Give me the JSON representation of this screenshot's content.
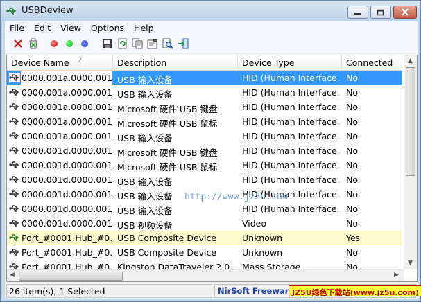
{
  "window": {
    "title": "USBDeview"
  },
  "menu": [
    "File",
    "Edit",
    "View",
    "Options",
    "Help"
  ],
  "toolbar": {
    "buttons": [
      "disconnect-icon",
      "uninstall-icon",
      "red-dot-icon",
      "green-dot-icon",
      "blue-dot-icon",
      "save-icon",
      "refresh-icon",
      "copy-icon",
      "properties-icon",
      "find-icon",
      "exit-icon"
    ],
    "colors": {
      "red": "#e00000",
      "green": "#10c010",
      "blue": "#1030e0"
    }
  },
  "columns": [
    "Device Name",
    "Description",
    "Device Type",
    "Connected"
  ],
  "rows": [
    {
      "name": "0000.001a.0000.001...",
      "description": "USB 输入设备",
      "type": "HID (Human Interface...",
      "connected": "No",
      "selected": true
    },
    {
      "name": "0000.001a.0000.001...",
      "description": "USB 输入设备",
      "type": "HID (Human Interface...",
      "connected": "No"
    },
    {
      "name": "0000.001a.0000.001...",
      "description": "Microsoft 硬件 USB 键盘",
      "type": "HID (Human Interface...",
      "connected": "No"
    },
    {
      "name": "0000.001a.0000.001...",
      "description": "Microsoft 硬件 USB 鼠标",
      "type": "HID (Human Interface...",
      "connected": "No"
    },
    {
      "name": "0000.001a.0000.001...",
      "description": "USB 输入设备",
      "type": "HID (Human Interface...",
      "connected": "No"
    },
    {
      "name": "0000.001d.0000.001...",
      "description": "Microsoft 硬件 USB 键盘",
      "type": "HID (Human Interface...",
      "connected": "No"
    },
    {
      "name": "0000.001d.0000.001...",
      "description": "Microsoft 硬件 USB 鼠标",
      "type": "HID (Human Interface...",
      "connected": "No"
    },
    {
      "name": "0000.001d.0000.001...",
      "description": "USB 输入设备",
      "type": "HID (Human Interface...",
      "connected": "No"
    },
    {
      "name": "0000.001d.0000.001...",
      "description": "USB 输入设备",
      "type": "HID (Human Interface...",
      "connected": "No"
    },
    {
      "name": "0000.001d.0000.001...",
      "description": "USB 输入设备",
      "type": "HID (Human Interface...",
      "connected": "No"
    },
    {
      "name": "0000.001d.0000.001...",
      "description": "USB 视频设备",
      "type": "Video",
      "connected": "No"
    },
    {
      "name": "Port_#0001.Hub_#0...",
      "description": "USB Composite Device",
      "type": "Unknown",
      "connected": "Yes",
      "highlight": true
    },
    {
      "name": "Port_#0001.Hub_#0...",
      "description": "USB Composite Device",
      "type": "Unknown",
      "connected": "No"
    },
    {
      "name": "Port_#0001.Hub_#0...",
      "description": "Kingston DataTraveler 2.0",
      "type": "Mass Storage",
      "connected": "No"
    }
  ],
  "watermark": "http://www.jz5u.com",
  "status": {
    "items": "26 item(s), 1 Selected",
    "credit": "NirSoft Freeware.",
    "badge": "JZ5U绿色下载站(www.jz5u.com)"
  }
}
